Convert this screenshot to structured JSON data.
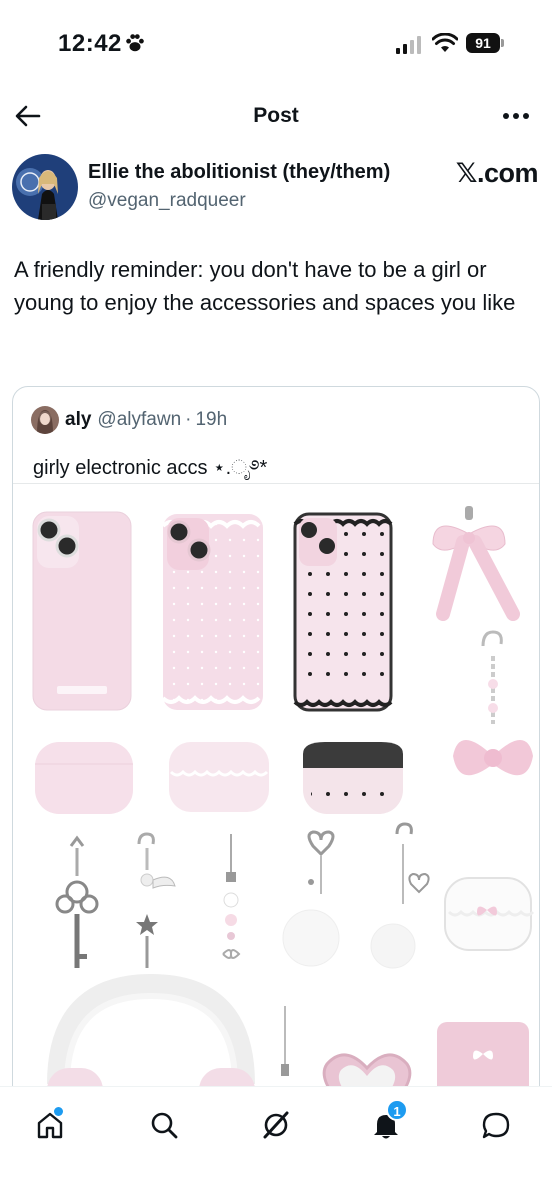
{
  "status_bar": {
    "time": "12:42",
    "battery": "91"
  },
  "header": {
    "title": "Post"
  },
  "author": {
    "display_name": "Ellie the abolitionist (they/them)",
    "handle": "@vegan_radqueer",
    "watermark": "𝕏.com"
  },
  "post": {
    "text": "A friendly reminder: you don't have to be a girl or young to enjoy the accessories and spaces you like"
  },
  "quote": {
    "name": "aly",
    "handle": "@alyfawn",
    "separator": "·",
    "time": "19h",
    "text": "girly electronic accs ⋆.ೃ࿔*"
  },
  "nav": {
    "notifications_count": "1"
  },
  "icons": [
    "paw-icon",
    "signal-icon",
    "wifi-icon",
    "back-arrow-icon",
    "more-icon",
    "home-icon",
    "search-icon",
    "grok-icon",
    "bell-icon",
    "chat-icon"
  ],
  "colors": {
    "accent": "#1d9bf0",
    "text": "#0f1419",
    "secondary": "#536471",
    "pink": "#f4d8e4"
  }
}
